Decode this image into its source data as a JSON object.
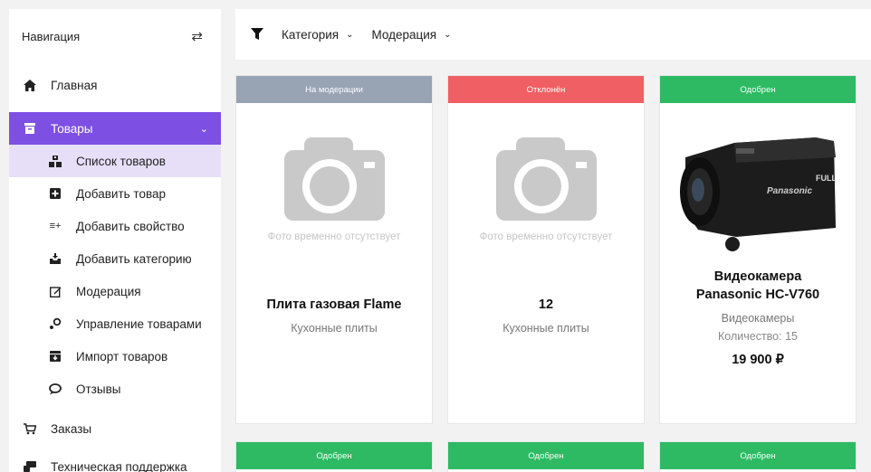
{
  "sidebar": {
    "title": "Навигация",
    "items": [
      {
        "label": "Главная",
        "icon": "home-icon"
      },
      {
        "label": "Товары",
        "icon": "archive-icon"
      },
      {
        "label": "Заказы",
        "icon": "cart-icon"
      },
      {
        "label": "Техническая поддержка",
        "icon": "support-icon"
      }
    ],
    "subitems": [
      {
        "label": "Список товаров",
        "icon": "boxes-icon"
      },
      {
        "label": "Добавить товар",
        "icon": "plus-square-icon"
      },
      {
        "label": "Добавить свойство",
        "icon": "add-property-icon"
      },
      {
        "label": "Добавить категорию",
        "icon": "add-category-icon"
      },
      {
        "label": "Модерация",
        "icon": "edit-icon"
      },
      {
        "label": "Управление товарами",
        "icon": "manage-icon"
      },
      {
        "label": "Импорт товаров",
        "icon": "import-icon"
      },
      {
        "label": "Отзывы",
        "icon": "reviews-icon"
      }
    ]
  },
  "filters": {
    "category": "Категория",
    "moderation": "Модерация"
  },
  "products": [
    {
      "status": "На модерации",
      "status_color": "#98a3b3",
      "no_photo": "Фото временно отсутствует",
      "name": "Плита газовая Flame",
      "category": "Кухонные плиты"
    },
    {
      "status": "Отклонён",
      "status_color": "#ef5f63",
      "no_photo": "Фото временно отсутствует",
      "name": "12",
      "category": "Кухонные плиты"
    },
    {
      "status": "Одобрен",
      "status_color": "#2dba63",
      "name": "Видеокамера Panasonic HC-V760",
      "category": "Видеокамеры",
      "quantity": "Количество: 15",
      "price": "19 900 ₽"
    },
    {
      "status": "Одобрен",
      "status_color": "#2dba63"
    },
    {
      "status": "Одобрен",
      "status_color": "#2dba63"
    },
    {
      "status": "Одобрен",
      "status_color": "#2dba63"
    }
  ],
  "colors": {
    "accent": "#7d4fe3",
    "accent_light": "#e7dff8",
    "background": "#f2f2f2"
  }
}
